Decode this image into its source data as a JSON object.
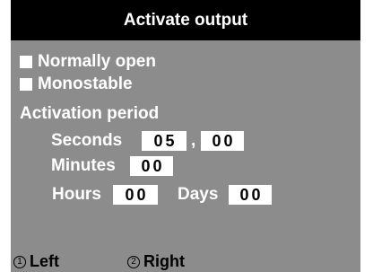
{
  "header": {
    "title": "Activate output"
  },
  "options": [
    {
      "label": "Normally open",
      "checked": false
    },
    {
      "label": "Monostable",
      "checked": false
    }
  ],
  "activation": {
    "title": "Activation period",
    "seconds_label": "Seconds",
    "seconds_int": "05",
    "seconds_sep": ",",
    "seconds_frac": "00",
    "minutes_label": "Minutes",
    "minutes": "00",
    "hours_label": "Hours",
    "hours": "00",
    "days_label": "Days",
    "days": "00"
  },
  "footer": {
    "left_key": "1",
    "left_label": "Left",
    "right_key": "2",
    "right_label": "Right"
  },
  "colors": {
    "header_bg": "#000000",
    "body_bg": "#8c8c8c",
    "text": "#ffffff"
  }
}
